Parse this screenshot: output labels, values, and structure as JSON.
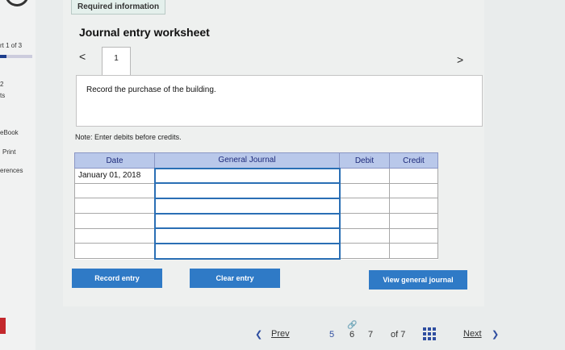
{
  "sidebar": {
    "part_label": "rt 1 of 3",
    "points_num": "2",
    "points_label": "ts",
    "ebook": "eBook",
    "print": "Print",
    "references": "erences"
  },
  "header": {
    "required_info": "Required information"
  },
  "worksheet": {
    "title": "Journal entry worksheet",
    "prev_arrow": "<",
    "next_arrow": ">",
    "current_tab": "1",
    "description": "Record the purchase of the building.",
    "note": "Note: Enter debits before credits."
  },
  "table": {
    "headers": [
      "Date",
      "General Journal",
      "Debit",
      "Credit"
    ],
    "rows": [
      [
        "January 01, 2018",
        "",
        "",
        ""
      ],
      [
        "",
        "",
        "",
        ""
      ],
      [
        "",
        "",
        "",
        ""
      ],
      [
        "",
        "",
        "",
        ""
      ],
      [
        "",
        "",
        "",
        ""
      ],
      [
        "",
        "",
        "",
        ""
      ]
    ]
  },
  "buttons": {
    "record": "Record entry",
    "clear": "Clear entry",
    "view": "View general journal"
  },
  "footer": {
    "prev": "Prev",
    "page5": "5",
    "page6": "6",
    "page7": "7",
    "of_total": "of 7",
    "next": "Next"
  },
  "colors": {
    "accent": "#2f7ac6",
    "header_bg": "#b9c8ea",
    "flag": "#c3282c"
  }
}
